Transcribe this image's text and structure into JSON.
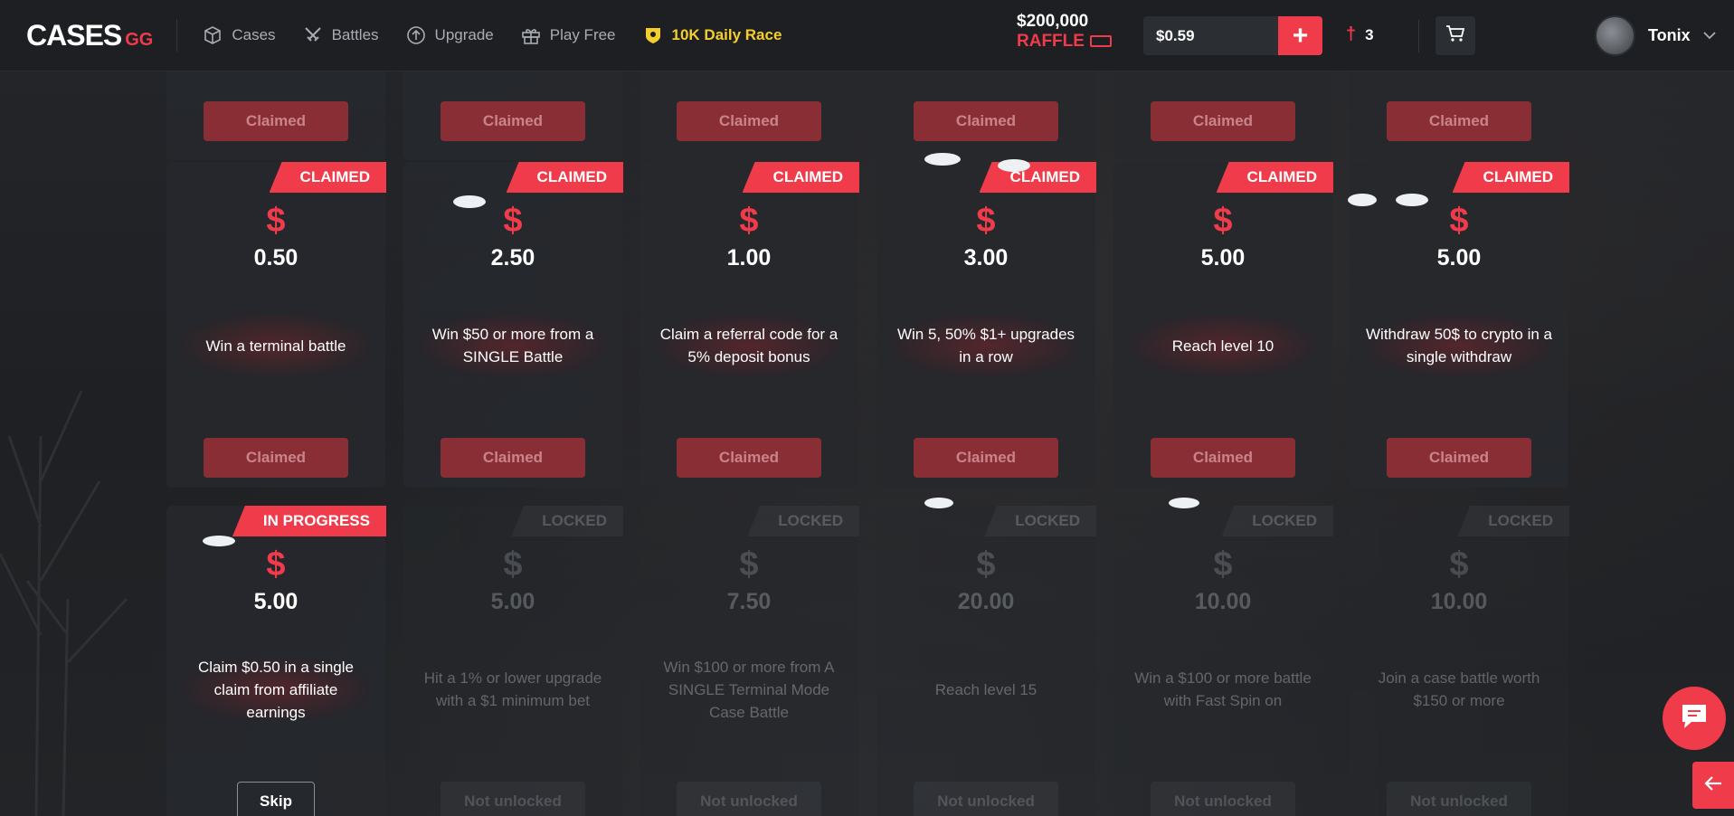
{
  "header": {
    "logo_main": "CASES",
    "logo_suffix": "GG",
    "nav": [
      {
        "label": "Cases",
        "icon": "box-icon"
      },
      {
        "label": "Battles",
        "icon": "swords-icon"
      },
      {
        "label": "Upgrade",
        "icon": "upgrade-icon"
      },
      {
        "label": "Play Free",
        "icon": "gift-icon"
      },
      {
        "label": "10K Daily Race",
        "icon": "badge-icon"
      }
    ],
    "raffle_amount": "$200,000",
    "raffle_label": "RAFFLE",
    "balance": "$0.59",
    "deposit_label": "+",
    "candy_count": "3",
    "username": "Tonix"
  },
  "top_row": {
    "buttons": [
      "Claimed",
      "Claimed",
      "Claimed",
      "Claimed",
      "Claimed",
      "Claimed"
    ]
  },
  "rows": [
    [
      {
        "badge": "CLAIMED",
        "currency": "$",
        "value": "0.50",
        "task": "Win a terminal battle",
        "button": "Claimed"
      },
      {
        "badge": "CLAIMED",
        "currency": "$",
        "value": "2.50",
        "task": "Win $50 or more from a SINGLE Battle",
        "button": "Claimed"
      },
      {
        "badge": "CLAIMED",
        "currency": "$",
        "value": "1.00",
        "task": "Claim a referral code for a 5% deposit bonus",
        "button": "Claimed"
      },
      {
        "badge": "CLAIMED",
        "currency": "$",
        "value": "3.00",
        "task": "Win 5, 50% $1+ upgrades in a row",
        "button": "Claimed"
      },
      {
        "badge": "CLAIMED",
        "currency": "$",
        "value": "5.00",
        "task": "Reach level 10",
        "button": "Claimed"
      },
      {
        "badge": "CLAIMED",
        "currency": "$",
        "value": "5.00",
        "task": "Withdraw 50$ to crypto in a single withdraw",
        "button": "Claimed"
      }
    ],
    [
      {
        "badge": "IN PROGRESS",
        "currency": "$",
        "value": "5.00",
        "task": "Claim $0.50 in a single claim from affiliate earnings",
        "button": "Skip"
      },
      {
        "badge": "LOCKED",
        "currency": "$",
        "value": "5.00",
        "task": "Hit a 1% or lower upgrade with a $1 minimum bet",
        "button": "Not unlocked"
      },
      {
        "badge": "LOCKED",
        "currency": "$",
        "value": "7.50",
        "task": "Win $100 or more from A SINGLE Terminal Mode Case Battle",
        "button": "Not unlocked"
      },
      {
        "badge": "LOCKED",
        "currency": "$",
        "value": "20.00",
        "task": "Reach level 15",
        "button": "Not unlocked"
      },
      {
        "badge": "LOCKED",
        "currency": "$",
        "value": "10.00",
        "task": "Win a $100 or more battle with Fast Spin on",
        "button": "Not unlocked"
      },
      {
        "badge": "LOCKED",
        "currency": "$",
        "value": "10.00",
        "task": "Join a case battle worth $150 or more",
        "button": "Not unlocked"
      }
    ]
  ],
  "colors": {
    "accent": "#ef3b4a",
    "race": "#f4cf2c",
    "claimed_button": "#8a2e36"
  }
}
